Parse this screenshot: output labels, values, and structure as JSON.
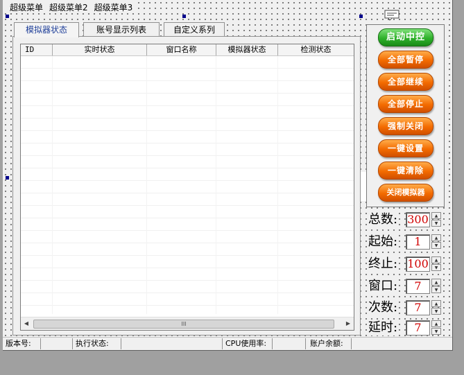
{
  "menu": [
    "超级菜单",
    "超级菜单2",
    "超级菜单3"
  ],
  "tabs": [
    "模拟器状态",
    "账号显示列表",
    "自定义系列"
  ],
  "listview": {
    "columns": [
      "ID",
      "实时状态",
      "窗口名称",
      "模拟器状态",
      "检测状态"
    ],
    "scroll_label": "III"
  },
  "buttons": {
    "start": "启动中控",
    "pause_all": "全部暂停",
    "resume_all": "全部继续",
    "stop_all": "全部停止",
    "force_close": "强制关闭",
    "one_key_setup": "一键设置",
    "one_key_clear": "一键清除",
    "close_emulator": "关闭模拟器"
  },
  "fields": [
    {
      "label": "总数:",
      "value": "300"
    },
    {
      "label": "起始:",
      "value": "1"
    },
    {
      "label": "终止:",
      "value": "100"
    },
    {
      "label": "窗口:",
      "value": "7"
    },
    {
      "label": "次数:",
      "value": "7"
    },
    {
      "label": "延时:",
      "value": "7"
    }
  ],
  "statusbar": {
    "version": "版本号:",
    "exec_state": "执行状态:",
    "cpu": "CPU使用率:",
    "balance": "账户余额:"
  },
  "colors": {
    "accent_orange": "#f36b00",
    "start_green": "#2fb12b",
    "value_red": "#d00000",
    "tab_active": "#1f3f99"
  }
}
